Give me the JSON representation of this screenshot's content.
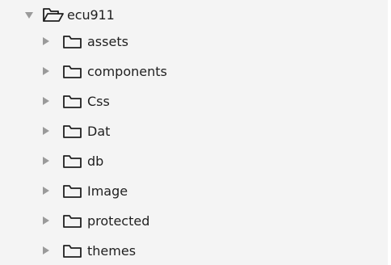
{
  "tree": {
    "root": {
      "label": "ecu911",
      "expanded": true,
      "icon": "folder-open-icon",
      "arrow_icon": "chevron-down-icon"
    },
    "children": [
      {
        "label": "assets",
        "icon": "folder-icon",
        "arrow_icon": "chevron-right-icon"
      },
      {
        "label": "components",
        "icon": "folder-icon",
        "arrow_icon": "chevron-right-icon"
      },
      {
        "label": "Css",
        "icon": "folder-icon",
        "arrow_icon": "chevron-right-icon"
      },
      {
        "label": "Dat",
        "icon": "folder-icon",
        "arrow_icon": "chevron-right-icon"
      },
      {
        "label": "db",
        "icon": "folder-icon",
        "arrow_icon": "chevron-right-icon"
      },
      {
        "label": "Image",
        "icon": "folder-icon",
        "arrow_icon": "chevron-right-icon"
      },
      {
        "label": "protected",
        "icon": "folder-icon",
        "arrow_icon": "chevron-right-icon"
      },
      {
        "label": "themes",
        "icon": "folder-icon",
        "arrow_icon": "chevron-right-icon"
      }
    ]
  },
  "colors": {
    "panel_background": "#f4f4f4",
    "text": "#1f1f1f",
    "arrow": "#9a9a9a",
    "icon_stroke": "#1f1f1f"
  }
}
